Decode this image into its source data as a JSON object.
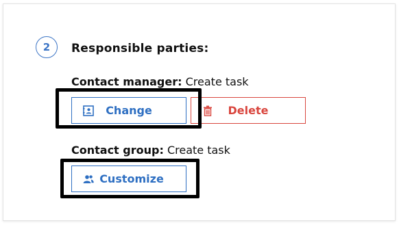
{
  "step": {
    "number": "2"
  },
  "section": {
    "title": "Responsible parties:"
  },
  "contact_manager": {
    "label": "Contact manager:",
    "value": "Create task",
    "change_label": "Change",
    "delete_label": "Delete"
  },
  "contact_group": {
    "label": "Contact group:",
    "value": "Create task",
    "customize_label": "Customize"
  },
  "colors": {
    "accent_blue": "#2e6fc2",
    "danger_red": "#d9463e",
    "highlight": "#000000"
  },
  "icons": {
    "change": "contact-card-icon",
    "delete": "trash-icon",
    "customize": "users-icon"
  }
}
